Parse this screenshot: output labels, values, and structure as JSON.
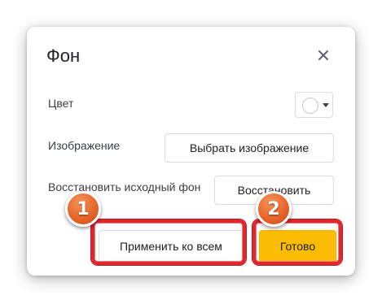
{
  "dialog": {
    "title": "Фон",
    "color_label": "Цвет",
    "image_label": "Изображение",
    "reset_label": "Восстановить исходный фон",
    "choose_image_button": "Выбрать изображение",
    "restore_button": "Восстановить",
    "apply_all_button": "Применить ко всем",
    "done_button": "Готово",
    "current_color": "#ffffff",
    "icons": {
      "close": "close-icon",
      "color_dropdown": "chevron-down-icon"
    },
    "accent_color": "#fbbc04"
  },
  "annotations": {
    "marker_1": "1",
    "marker_2": "2",
    "highlight_color": "#e1262c"
  }
}
